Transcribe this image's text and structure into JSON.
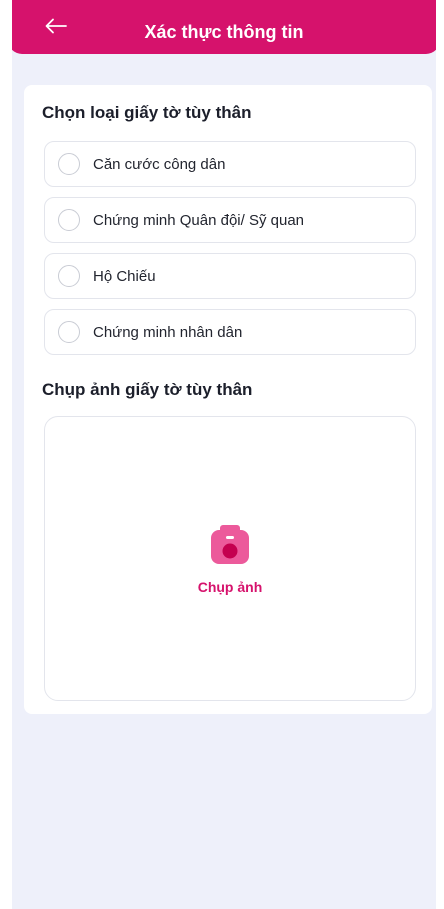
{
  "header": {
    "title": "Xác thực thông tin",
    "back_icon": "arrow-left-icon"
  },
  "id_section": {
    "title": "Chọn loại giấy tờ tùy thân",
    "options": [
      {
        "label": "Căn cước công dân",
        "selected": false
      },
      {
        "label": "Chứng minh Quân đội/ Sỹ quan",
        "selected": false
      },
      {
        "label": "Hộ Chiếu",
        "selected": false
      },
      {
        "label": "Chứng minh nhân dân",
        "selected": false
      }
    ]
  },
  "photo_section": {
    "title": "Chụp ảnh giấy tờ tùy thân",
    "capture_label": "Chụp ảnh",
    "capture_icon": "camera-icon"
  },
  "colors": {
    "brand": "#d6126c",
    "camera": "#ec5a9b",
    "background": "#eef0fa"
  }
}
